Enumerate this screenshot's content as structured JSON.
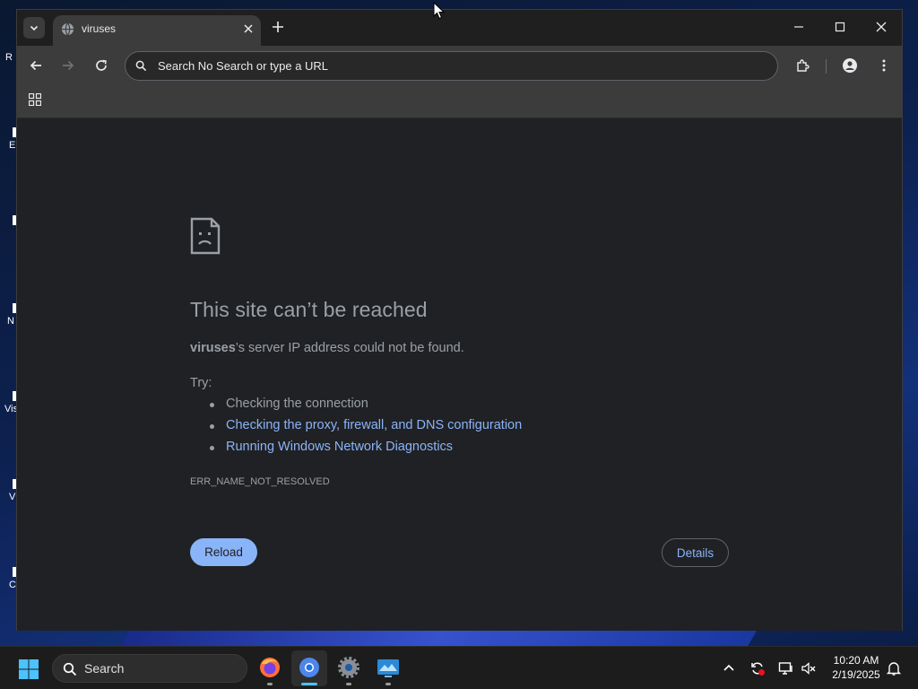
{
  "desktop": {
    "icon_labels": [
      "R",
      "E",
      "N",
      "Vis",
      "V",
      "C"
    ]
  },
  "tab": {
    "title": "viruses",
    "favicon": "globe-icon"
  },
  "toolbar": {
    "omnibox_placeholder": "Search No Search or type a URL",
    "omnibox_value": ""
  },
  "error_page": {
    "title": "This site can’t be reached",
    "host": "viruses",
    "description_suffix": "’s server IP address could not be found.",
    "try_label": "Try:",
    "suggestions": [
      {
        "text": "Checking the connection",
        "link": false
      },
      {
        "text": "Checking the proxy, firewall, and DNS configuration",
        "link": true
      },
      {
        "text": "Running Windows Network Diagnostics",
        "link": true
      }
    ],
    "error_code": "ERR_NAME_NOT_RESOLVED",
    "reload_label": "Reload",
    "details_label": "Details"
  },
  "taskbar": {
    "search_label": "Search",
    "apps": [
      "firefox-icon",
      "chrome-icon",
      "settings-icon",
      "remote-desktop-icon"
    ],
    "clock_time": "10:20 AM",
    "clock_date": "2/19/2025"
  },
  "colors": {
    "accent": "#8ab4f8",
    "page_bg": "#202124",
    "toolbar_bg": "#3c3c3c",
    "muted_text": "#9aa0a6"
  }
}
